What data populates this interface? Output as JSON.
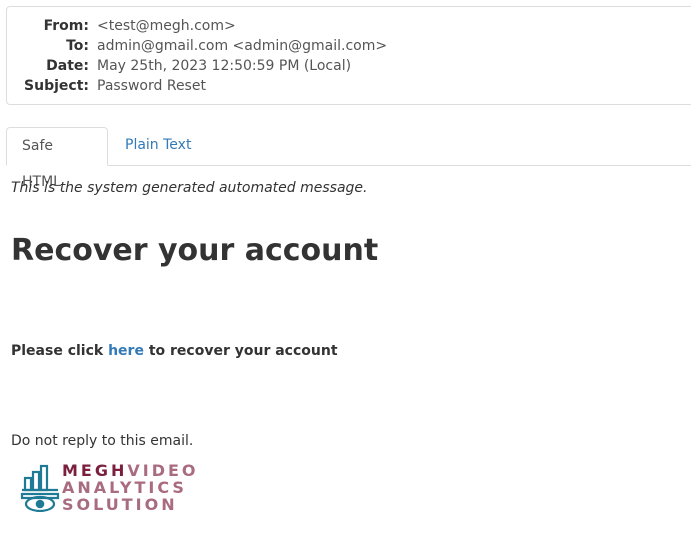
{
  "header": {
    "from_label": "From:",
    "from_value": "<test@megh.com>",
    "to_label": "To:",
    "to_value": "admin@gmail.com <admin@gmail.com>",
    "date_label": "Date:",
    "date_value": "May 25th, 2023 12:50:59 PM (Local)",
    "subject_label": "Subject:",
    "subject_value": "Password Reset"
  },
  "tabs": [
    {
      "label": "Safe HTML",
      "active": true
    },
    {
      "label": "Plain Text",
      "active": false
    }
  ],
  "message": {
    "intro": "This is the system generated automated message.",
    "title": "Recover your account",
    "action_prefix": "Please click ",
    "action_link": "here",
    "action_suffix": " to recover your account",
    "noreply": "Do not reply to this email."
  },
  "logo": {
    "word1": "MEGH",
    "word2": "VIDEO",
    "line2": "ANALYTICS",
    "line3": "SOLUTION",
    "color_primary": "#7a1f3d",
    "color_secondary": "#a86b80",
    "icon_color": "#1f7a96"
  },
  "colors": {
    "link": "#337ab7",
    "border": "#dddddd"
  }
}
